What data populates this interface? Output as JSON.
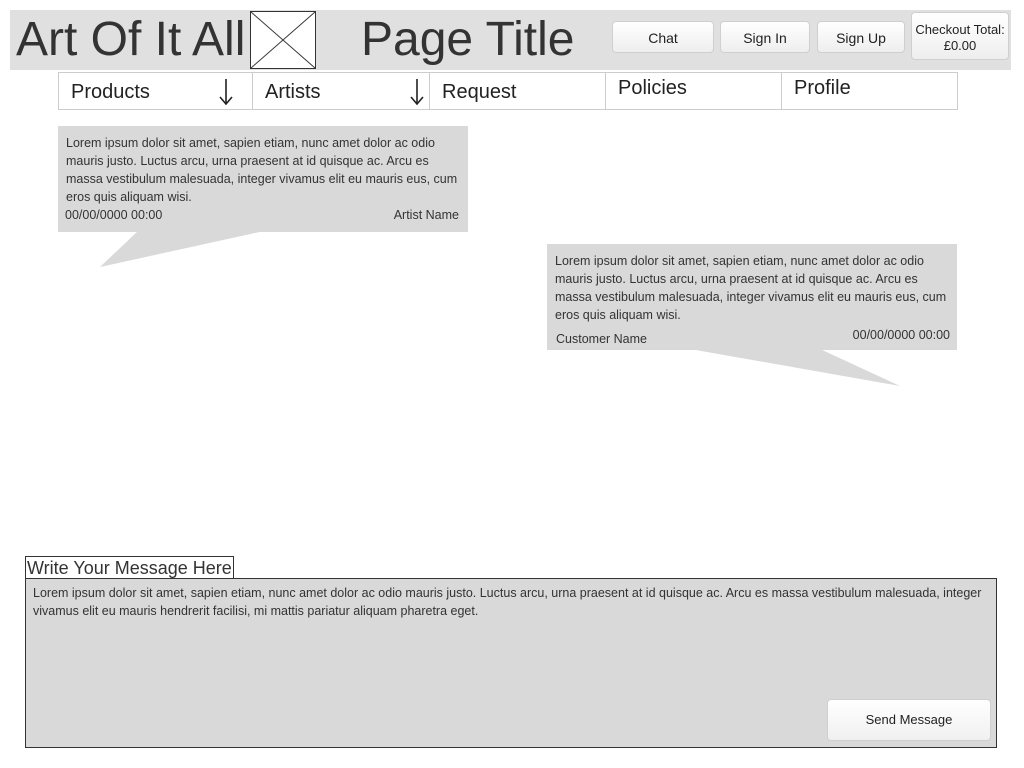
{
  "header": {
    "site_name": "Art Of It All",
    "page_title": "Page Title",
    "buttons": {
      "chat": "Chat",
      "sign_in": "Sign In",
      "sign_up": "Sign Up"
    },
    "checkout": {
      "label": "Checkout Total:",
      "amount": "£0.00"
    }
  },
  "nav": {
    "items": [
      {
        "label": "Products",
        "has_dropdown": true
      },
      {
        "label": "Artists",
        "has_dropdown": true
      },
      {
        "label": "Request",
        "has_dropdown": false
      },
      {
        "label": "Policies",
        "has_dropdown": false
      },
      {
        "label": "Profile",
        "has_dropdown": false
      }
    ],
    "dropdown_icon": "down-arrow-icon"
  },
  "messages": [
    {
      "text": "Lorem ipsum dolor sit amet, sapien etiam, nunc amet dolor ac odio mauris justo. Luctus arcu, urna praesent at id quisque ac. Arcu es massa vestibulum malesuada, integer vivamus elit eu mauris eus, cum eros quis aliquam wisi.",
      "timestamp": "00/00/0000 00:00",
      "author": "Artist Name"
    },
    {
      "text": "Lorem ipsum dolor sit amet, sapien etiam, nunc amet dolor ac odio mauris justo. Luctus arcu, urna praesent at id quisque ac. Arcu es massa vestibulum malesuada, integer vivamus elit eu mauris eus, cum eros quis aliquam wisi.",
      "timestamp": "00/00/0000 00:00",
      "author": "Customer Name"
    }
  ],
  "compose": {
    "label": "Write Your Message Here",
    "text": "Lorem ipsum dolor sit amet, sapien etiam, nunc amet dolor ac odio mauris justo. Luctus arcu, urna praesent at id quisque ac. Arcu es massa vestibulum malesuada, integer vivamus elit eu mauris hendrerit facilisi, mi mattis pariatur aliquam pharetra eget.",
    "send_label": "Send Message"
  },
  "colors": {
    "header_bg": "#e0e0e0",
    "bubble_bg": "#d9d9d9",
    "text": "#333333",
    "border": "#cccccc"
  }
}
